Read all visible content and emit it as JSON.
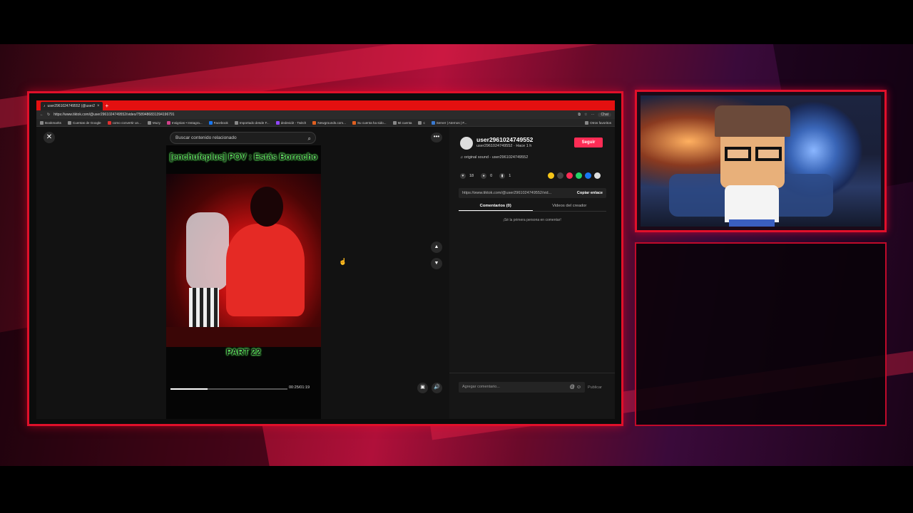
{
  "browser": {
    "tab_title": "user2961024749552 (@user2",
    "url": "https://www.tiktok.com/@user2961024749552/video/7589486831394196791",
    "chat_label": "Chat",
    "bookmarks": [
      "Bookmarks",
      "Cuentas de Google",
      "como convertir un...",
      "Muzy",
      "Insignias • Instagra...",
      "Facebook",
      "Importado desde F...",
      "dedevid2 - Twitch",
      "Newgrounds.com...",
      "Su cuenta ha sido...",
      "Mi cuenta",
      "c",
      "Server | Aternos | F..."
    ],
    "other_favorites": "Otros favoritos"
  },
  "tiktok": {
    "search_placeholder": "Buscar contenido relacionado",
    "video_title": "[enchufeplus] POV : Estás Borracho",
    "video_part": "PART 22",
    "time": "00:25/01:19",
    "progress_fraction": 0.32,
    "username": "user2961024749552",
    "user_sub": "user2961024749552 · Hace 1 h",
    "follow_label": "Seguir",
    "sound": "original sound - user2961024749552",
    "likes": "18",
    "comments": "0",
    "saves": "1",
    "link": "https://www.tiktok.com/@user2961024749552/vid...",
    "copy_label": "Copiar enlace",
    "tab_comments": "Comentarios (0)",
    "tab_videos": "Videos del creador",
    "no_comments": "¡Sé la primera persona en comentar!",
    "comment_placeholder": "Agregar comentario...",
    "publish_label": "Publicar",
    "share_colors": [
      "#f5c518",
      "#444444",
      "#fe2c55",
      "#25d366",
      "#1877f2",
      "#dddddd"
    ]
  }
}
